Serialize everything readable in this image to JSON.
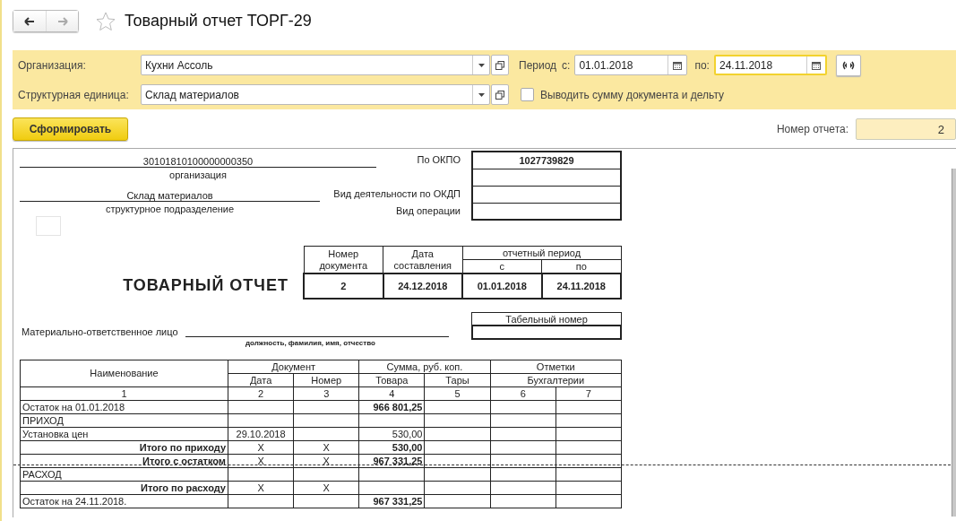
{
  "header": {
    "title": "Товарный отчет ТОРГ-29",
    "favorite": false
  },
  "filters": {
    "organization": {
      "label": "Организация:",
      "value": "Кухни Ассоль"
    },
    "unit": {
      "label": "Структурная единица:",
      "value": "Склад материалов"
    },
    "period": {
      "label": "Период",
      "from_label": "с:",
      "from": "01.01.2018",
      "to_label": "по:",
      "to": "24.11.2018",
      "to_focused": true
    },
    "show_sum": {
      "label": "Выводить сумму документа и дельту",
      "checked": false
    }
  },
  "generate_button": "Сформировать",
  "report_number": {
    "label": "Номер отчета:",
    "value": "2"
  },
  "report": {
    "organization": {
      "value": "30101810100000000350",
      "caption": "организация"
    },
    "division": {
      "value": "Склад материалов",
      "caption": "структурное подразделение"
    },
    "okpo": {
      "label": "По ОКПО",
      "value": "1027739829"
    },
    "code_labels": [
      "Вид деятельности по ОКДП",
      "Вид операции"
    ],
    "title": "ТОВАРНЫЙ ОТЧЕТ",
    "doc_header": {
      "number_label": "Номер документа",
      "date_label": "Дата составления",
      "period_label": "отчетный период",
      "from_label": "с",
      "to_label": "по",
      "number": "2",
      "date": "24.12.2018",
      "from": "01.01.2018",
      "to": "24.11.2018"
    },
    "responsible": {
      "label": "Материально-ответственное лицо",
      "caption": "должность, фамилия, имя, отчество"
    },
    "tab_number_label": "Табельный номер",
    "table": {
      "group_headers": [
        "Наименование",
        "Документ",
        "Сумма, руб. коп.",
        "Отметки"
      ],
      "sub_headers": [
        "Дата",
        "Номер",
        "Товара",
        "Тары",
        "Бухгалтерии"
      ],
      "numbers": [
        "1",
        "2",
        "3",
        "4",
        "5",
        "6",
        "7"
      ],
      "rows": [
        {
          "kind": "balance",
          "cells": [
            "Остаток на 01.01.2018",
            null,
            null,
            "966 801,25",
            null,
            null,
            null
          ]
        },
        {
          "kind": "section",
          "cells": [
            "ПРИХОД",
            null,
            null,
            null,
            null,
            null,
            null
          ]
        },
        {
          "kind": "line",
          "cells": [
            "Установка цен",
            "29.10.2018",
            null,
            "530,00",
            null,
            null,
            null
          ]
        },
        {
          "kind": "total",
          "cells": [
            "Итого по приходу",
            "X",
            "X",
            "530,00",
            null,
            null,
            null
          ]
        },
        {
          "kind": "total",
          "cells": [
            "Итого с остатком",
            "X",
            "X",
            "967 331,25",
            null,
            null,
            null
          ]
        },
        {
          "kind": "section",
          "cells": [
            "РАСХОД",
            null,
            null,
            null,
            null,
            null,
            null
          ]
        },
        {
          "kind": "total",
          "cells": [
            "Итого по расходу",
            "X",
            "X",
            null,
            null,
            null,
            null
          ]
        },
        {
          "kind": "balance",
          "cells": [
            "Остаток на 24.11.2018.",
            null,
            null,
            "967 331,25",
            null,
            null,
            null
          ]
        }
      ]
    }
  }
}
